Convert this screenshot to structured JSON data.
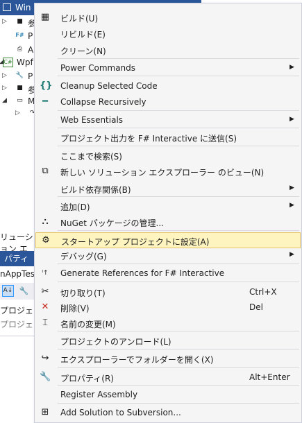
{
  "background": {
    "solution_explorer": {
      "root_label": "Win",
      "tree": [
        {
          "label": "参",
          "glyph": "■",
          "expand": "▷"
        },
        {
          "label": "P",
          "glyph": "F#",
          "expand": ""
        },
        {
          "label": "A",
          "glyph": "⎙",
          "expand": ""
        },
        {
          "label": "Wpf",
          "glyph": "C#",
          "expand": "◢"
        },
        {
          "label": "P",
          "glyph": "🔧",
          "expand": "▷"
        },
        {
          "label": "参",
          "glyph": "■",
          "expand": "▷"
        },
        {
          "label": "M",
          "glyph": "▭",
          "expand": "◢"
        },
        {
          "label": "",
          "glyph": "↷",
          "expand": "▷"
        }
      ]
    },
    "panel_label": "リューション エ",
    "properties": {
      "title": "パティ",
      "subtitle": "nAppTest",
      "toolbar_sort_icon": "az-sort-icon",
      "toolbar_wrench_icon": "wrench-icon",
      "rows": [
        "プロジェクト",
        "プロジェクト"
      ]
    }
  },
  "context_menu": {
    "items": [
      {
        "id": "build",
        "label": "ビルド(U)",
        "icon": "build-icon",
        "glyph": "▦",
        "shortcut": "",
        "submenu": false
      },
      {
        "id": "rebuild",
        "label": "リビルド(E)",
        "icon": "",
        "glyph": "",
        "shortcut": "",
        "submenu": false
      },
      {
        "id": "clean",
        "label": "クリーン(N)",
        "icon": "",
        "glyph": "",
        "shortcut": "",
        "submenu": false
      },
      {
        "id": "power-commands",
        "label": "Power Commands",
        "icon": "",
        "glyph": "",
        "shortcut": "",
        "submenu": true
      },
      {
        "id": "cleanup-selected-code",
        "label": "Cleanup Selected Code",
        "icon": "braces-icon",
        "glyph": "{}",
        "shortcut": "",
        "submenu": false
      },
      {
        "id": "collapse-recursively",
        "label": "Collapse Recursively",
        "icon": "minus-icon",
        "glyph": "━",
        "shortcut": "",
        "submenu": false
      },
      {
        "id": "web-essentials",
        "label": "Web Essentials",
        "icon": "",
        "glyph": "",
        "shortcut": "",
        "submenu": true
      },
      {
        "id": "send-to-fsi",
        "label": "プロジェクト出力を F# Interactive に送信(S)",
        "icon": "",
        "glyph": "",
        "shortcut": "",
        "submenu": false
      },
      {
        "id": "scope-to-this",
        "label": "ここまで検索(S)",
        "icon": "",
        "glyph": "",
        "shortcut": "",
        "submenu": false
      },
      {
        "id": "new-explorer-view",
        "label": "新しい ソリューション エクスプローラー のビュー(N)",
        "icon": "new-view-icon",
        "glyph": "⧉",
        "shortcut": "",
        "submenu": false
      },
      {
        "id": "build-dependencies",
        "label": "ビルド依存関係(B)",
        "icon": "",
        "glyph": "",
        "shortcut": "",
        "submenu": true
      },
      {
        "id": "add",
        "label": "追加(D)",
        "icon": "",
        "glyph": "",
        "shortcut": "",
        "submenu": true
      },
      {
        "id": "nuget",
        "label": "NuGet パッケージの管理...",
        "icon": "nuget-icon",
        "glyph": "⛬",
        "shortcut": "",
        "submenu": false
      },
      {
        "id": "set-startup",
        "label": "スタートアップ プロジェクトに設定(A)",
        "icon": "gear-icon",
        "glyph": "⚙",
        "shortcut": "",
        "submenu": false
      },
      {
        "id": "debug",
        "label": "デバッグ(G)",
        "icon": "",
        "glyph": "",
        "shortcut": "",
        "submenu": true
      },
      {
        "id": "generate-refs",
        "label": "Generate References for F# Interactive",
        "icon": "fsi-icon",
        "glyph": "ᴵ↑",
        "shortcut": "",
        "submenu": false
      },
      {
        "id": "cut",
        "label": "切り取り(T)",
        "icon": "scissors-icon",
        "glyph": "✂",
        "shortcut": "Ctrl+X",
        "submenu": false
      },
      {
        "id": "delete",
        "label": "削除(V)",
        "icon": "delete-icon",
        "glyph": "✕",
        "shortcut": "Del",
        "submenu": false
      },
      {
        "id": "rename",
        "label": "名前の変更(M)",
        "icon": "rename-icon",
        "glyph": "⌶",
        "shortcut": "",
        "submenu": false
      },
      {
        "id": "unload-project",
        "label": "プロジェクトのアンロード(L)",
        "icon": "",
        "glyph": "",
        "shortcut": "",
        "submenu": false
      },
      {
        "id": "open-in-explorer",
        "label": "エクスプローラーでフォルダーを開く(X)",
        "icon": "open-folder-icon",
        "glyph": "↪",
        "shortcut": "",
        "submenu": false
      },
      {
        "id": "properties",
        "label": "プロパティ(R)",
        "icon": "wrench-icon",
        "glyph": "🔧",
        "shortcut": "Alt+Enter",
        "submenu": false
      },
      {
        "id": "register-assembly",
        "label": "Register Assembly",
        "icon": "",
        "glyph": "",
        "shortcut": "",
        "submenu": false
      },
      {
        "id": "add-to-subversion",
        "label": "Add Solution to Subversion...",
        "icon": "subversion-icon",
        "glyph": "⊞",
        "shortcut": "",
        "submenu": false
      }
    ],
    "highlighted": "set-startup",
    "colors": {
      "highlight_bg": "#fdf4bf",
      "highlight_border": "#e5c365",
      "accent_blue": "#2b579a",
      "icon_teal": "#1e7a74",
      "icon_red": "#c42b1c"
    }
  }
}
